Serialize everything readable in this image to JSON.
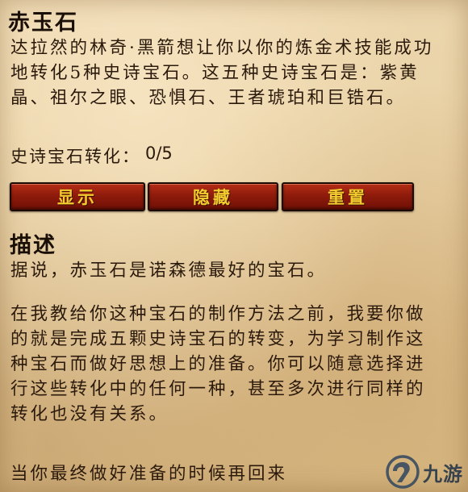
{
  "quest": {
    "title": "赤玉石",
    "objective": "达拉然的林奇·黑箭想让你以你的炼金术技能成功地转化5种史诗宝石。这五种史诗宝石是：紫黄晶、祖尔之眼、恐惧石、王者琥珀和巨锆石。",
    "progress_label": "史诗宝石转化",
    "progress_sep": "：",
    "progress_value": "0/5",
    "progress_fraction": 0.0
  },
  "buttons": {
    "show": "显示",
    "hide": "隐藏",
    "reset": "重置"
  },
  "description": {
    "heading": "描述",
    "paragraph_1": "据说，赤玉石是诺森德最好的宝石。",
    "paragraph_2": "在我教给你这种宝石的制作方法之前，我要你做的就是完成五颗史诗宝石的转变，为学习制作这种宝石而做好思想上的准备。你可以随意选择进行这些转化中的任何一种，甚至多次进行同样的转化也没有关系。",
    "paragraph_3": "当你最终做好准备的时候再回来"
  },
  "watermark": {
    "text": "九游",
    "logo_icon": "jiuyou-logo-icon"
  },
  "colors": {
    "button_face": "#8e1b0b",
    "button_text": "#f2cc2f",
    "parchment": "#e8d0a3",
    "body_text": "#2b1a0c"
  }
}
